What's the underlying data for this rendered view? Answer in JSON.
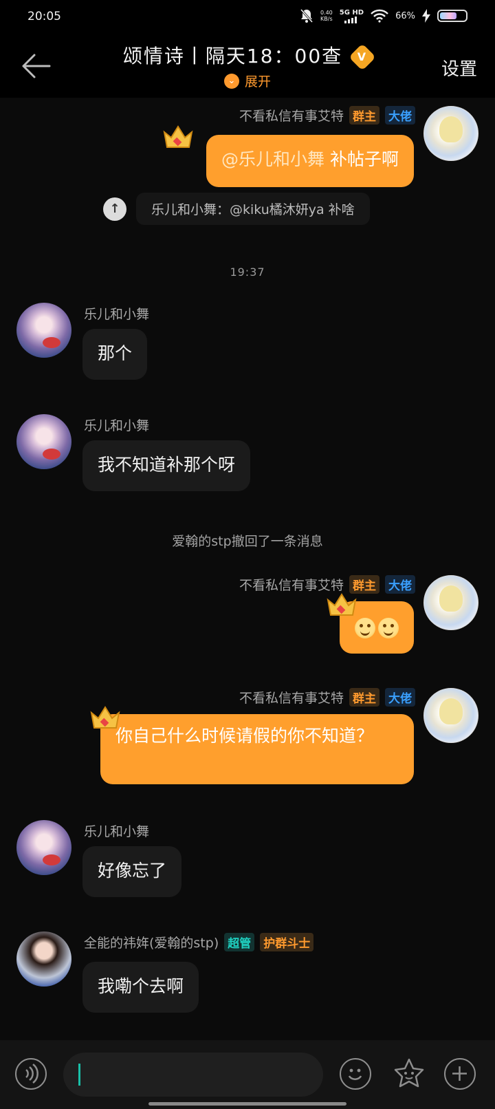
{
  "status_bar": {
    "time": "20:05",
    "net_speed_value": "0.40",
    "net_speed_unit": "KB/s",
    "network": "5G HD",
    "battery": "66%",
    "battery_level": 0.66
  },
  "header": {
    "title": "颂情诗丨隔天18：00查",
    "badge": "V",
    "expand_label": "展开",
    "settings_label": "设置"
  },
  "messages": [
    {
      "sender": "不看私信有事艾特",
      "tags": [
        "群主",
        "大佬"
      ],
      "text_mention": "@乐儿和小舞",
      "text_rest": " 补帖子啊"
    },
    {
      "quote": "乐儿和小舞：@kiku橘沐妍ya 补啥",
      "quote_icon": "↑"
    },
    {
      "timestamp": "19:37"
    },
    {
      "sender": "乐儿和小舞",
      "text": "那个"
    },
    {
      "sender": "乐儿和小舞",
      "text": "我不知道补那个呀"
    },
    {
      "system": "爱翰的stp撤回了一条消息"
    },
    {
      "sender": "不看私信有事艾特",
      "tags": [
        "群主",
        "大佬"
      ],
      "emoji": "smile-emoji"
    },
    {
      "sender": "不看私信有事艾特",
      "tags": [
        "群主",
        "大佬"
      ],
      "text": "你自己什么时候请假的你不知道？"
    },
    {
      "sender": "乐儿和小舞",
      "text": "好像忘了"
    },
    {
      "sender": "全能的祎姩(爱翰的stp)",
      "tags": [
        "超管",
        "护群斗士"
      ],
      "text": "我嘞个去啊"
    }
  ],
  "input_bar": {
    "voice_icon": "voice-icon",
    "emoji_icon": "emoji-icon",
    "sticker_icon": "sticker-icon",
    "plus_icon": "plus-icon"
  },
  "colors": {
    "accent": "#ff9f2d",
    "background": "#0b0b0b",
    "bubble_dark": "#1b1b1b"
  }
}
